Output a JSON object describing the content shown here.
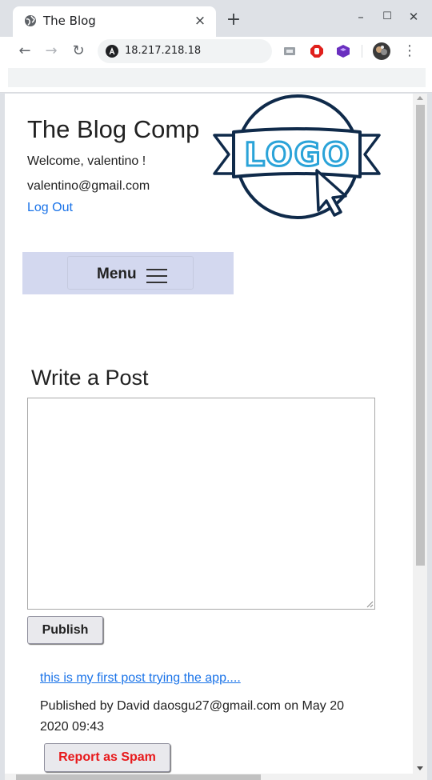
{
  "browser": {
    "tab_title": "The Blog",
    "tab_close": "×",
    "new_tab": "+",
    "minimize": "–",
    "maximize": "☐",
    "close": "✕",
    "url": "18.217.218.18",
    "back": "←",
    "forward": "→",
    "reload": "↻",
    "menu": "⋮"
  },
  "header": {
    "site_title": "The Blog Comp",
    "welcome": "Welcome, valentino !",
    "email": "valentino@gmail.com",
    "logout": "Log Out",
    "logo_text": "LOGO"
  },
  "nav": {
    "menu_label": "Menu"
  },
  "compose": {
    "title": "Write a Post",
    "textarea_value": "",
    "publish_label": "Publish"
  },
  "posts": [
    {
      "text": "this is my first post trying the app....",
      "meta": "Published by David daosgu27@gmail.com on May 20 2020 09:43",
      "spam_label": "Report as Spam"
    }
  ],
  "colors": {
    "link": "#1a73e8",
    "menu_band": "#d3d8ef",
    "spam_text": "#e8191b",
    "logo_dark": "#0f2a4a",
    "logo_accent": "#2aa3d8"
  }
}
